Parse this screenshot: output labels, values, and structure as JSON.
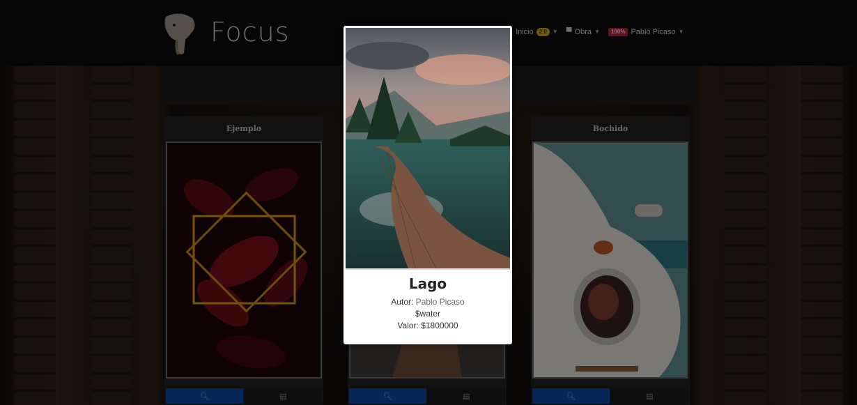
{
  "header": {
    "logo_text": "Focus",
    "nav": [
      {
        "label": "Inicio",
        "badge": "2.0"
      },
      {
        "label": "Obra"
      },
      {
        "label": "Pablo Picaso",
        "badge": "100%"
      }
    ]
  },
  "cards": [
    {
      "title": "Ejemplo"
    },
    {
      "title": ""
    },
    {
      "title": "Bochido"
    }
  ],
  "modal": {
    "title": "Lago",
    "author_label": "Autor:",
    "author_name": "Pablo Picaso",
    "tag": "$water",
    "value_label": "Valor: $1800000"
  },
  "icons": {
    "view": "magnifier-icon",
    "document": "document-icon"
  }
}
